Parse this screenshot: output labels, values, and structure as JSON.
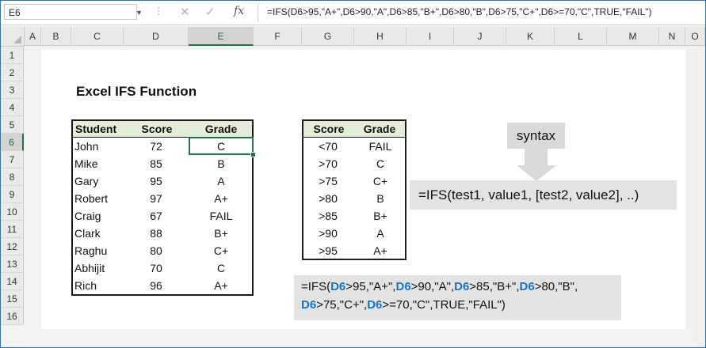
{
  "formula_bar": {
    "name_box": "E6",
    "formula": "=IFS(D6>95,\"A+\",D6>90,\"A\",D6>85,\"B+\",D6>80,\"B\",D6>75,\"C+\",D6>=70,\"C\",TRUE,\"FAIL\")",
    "fx_label": "fx"
  },
  "columns": [
    "A",
    "B",
    "C",
    "D",
    "E",
    "F",
    "G",
    "H",
    "I",
    "J",
    "K",
    "L",
    "M",
    "N",
    "O"
  ],
  "rows": [
    "1",
    "2",
    "3",
    "4",
    "5",
    "6",
    "7",
    "8",
    "9",
    "10",
    "11",
    "12",
    "13",
    "14",
    "15",
    "16"
  ],
  "selected_cell": "E6",
  "title": "Excel IFS Function",
  "students_table": {
    "headers": [
      "Student",
      "Score",
      "Grade"
    ],
    "rows": [
      {
        "student": "John",
        "score": "72",
        "grade": "C"
      },
      {
        "student": "Mike",
        "score": "85",
        "grade": "B"
      },
      {
        "student": "Gary",
        "score": "95",
        "grade": "A"
      },
      {
        "student": "Robert",
        "score": "97",
        "grade": "A+"
      },
      {
        "student": "Craig",
        "score": "67",
        "grade": "FAIL"
      },
      {
        "student": "Clark",
        "score": "88",
        "grade": "B+"
      },
      {
        "student": "Raghu",
        "score": "80",
        "grade": "C+"
      },
      {
        "student": "Abhijit",
        "score": "70",
        "grade": "C"
      },
      {
        "student": "Rich",
        "score": "96",
        "grade": "A+"
      }
    ]
  },
  "grade_table": {
    "headers": [
      "Score",
      "Grade"
    ],
    "rows": [
      {
        "score": "<70",
        "grade": "FAIL"
      },
      {
        "score": ">70",
        "grade": "C"
      },
      {
        "score": ">75",
        "grade": "C+"
      },
      {
        "score": ">80",
        "grade": "B"
      },
      {
        "score": ">85",
        "grade": "B+"
      },
      {
        "score": ">90",
        "grade": "A"
      },
      {
        "score": ">95",
        "grade": "A+"
      }
    ]
  },
  "syntax": {
    "label": "syntax",
    "text": "=IFS(test1, value1, [test2, value2], ..)"
  },
  "formula_display": {
    "line1": [
      {
        "t": "=IFS(",
        "ref": false
      },
      {
        "t": "D6",
        "ref": true
      },
      {
        "t": ">95,\"A+\",",
        "ref": false
      },
      {
        "t": "D6",
        "ref": true
      },
      {
        "t": ">90,\"A\",",
        "ref": false
      },
      {
        "t": "D6",
        "ref": true
      },
      {
        "t": ">85,\"B+\",",
        "ref": false
      },
      {
        "t": "D6",
        "ref": true
      },
      {
        "t": ">80,\"B\",",
        "ref": false
      }
    ],
    "line2": [
      {
        "t": "D6",
        "ref": true
      },
      {
        "t": ">75,\"C+\",",
        "ref": false
      },
      {
        "t": "D6",
        "ref": true
      },
      {
        "t": ">=70,\"C\",TRUE,\"FAIL\")",
        "ref": false
      }
    ]
  },
  "colors": {
    "accent": "#217346",
    "header_fill": "#e2eed9",
    "reference": "#1b73bf"
  }
}
